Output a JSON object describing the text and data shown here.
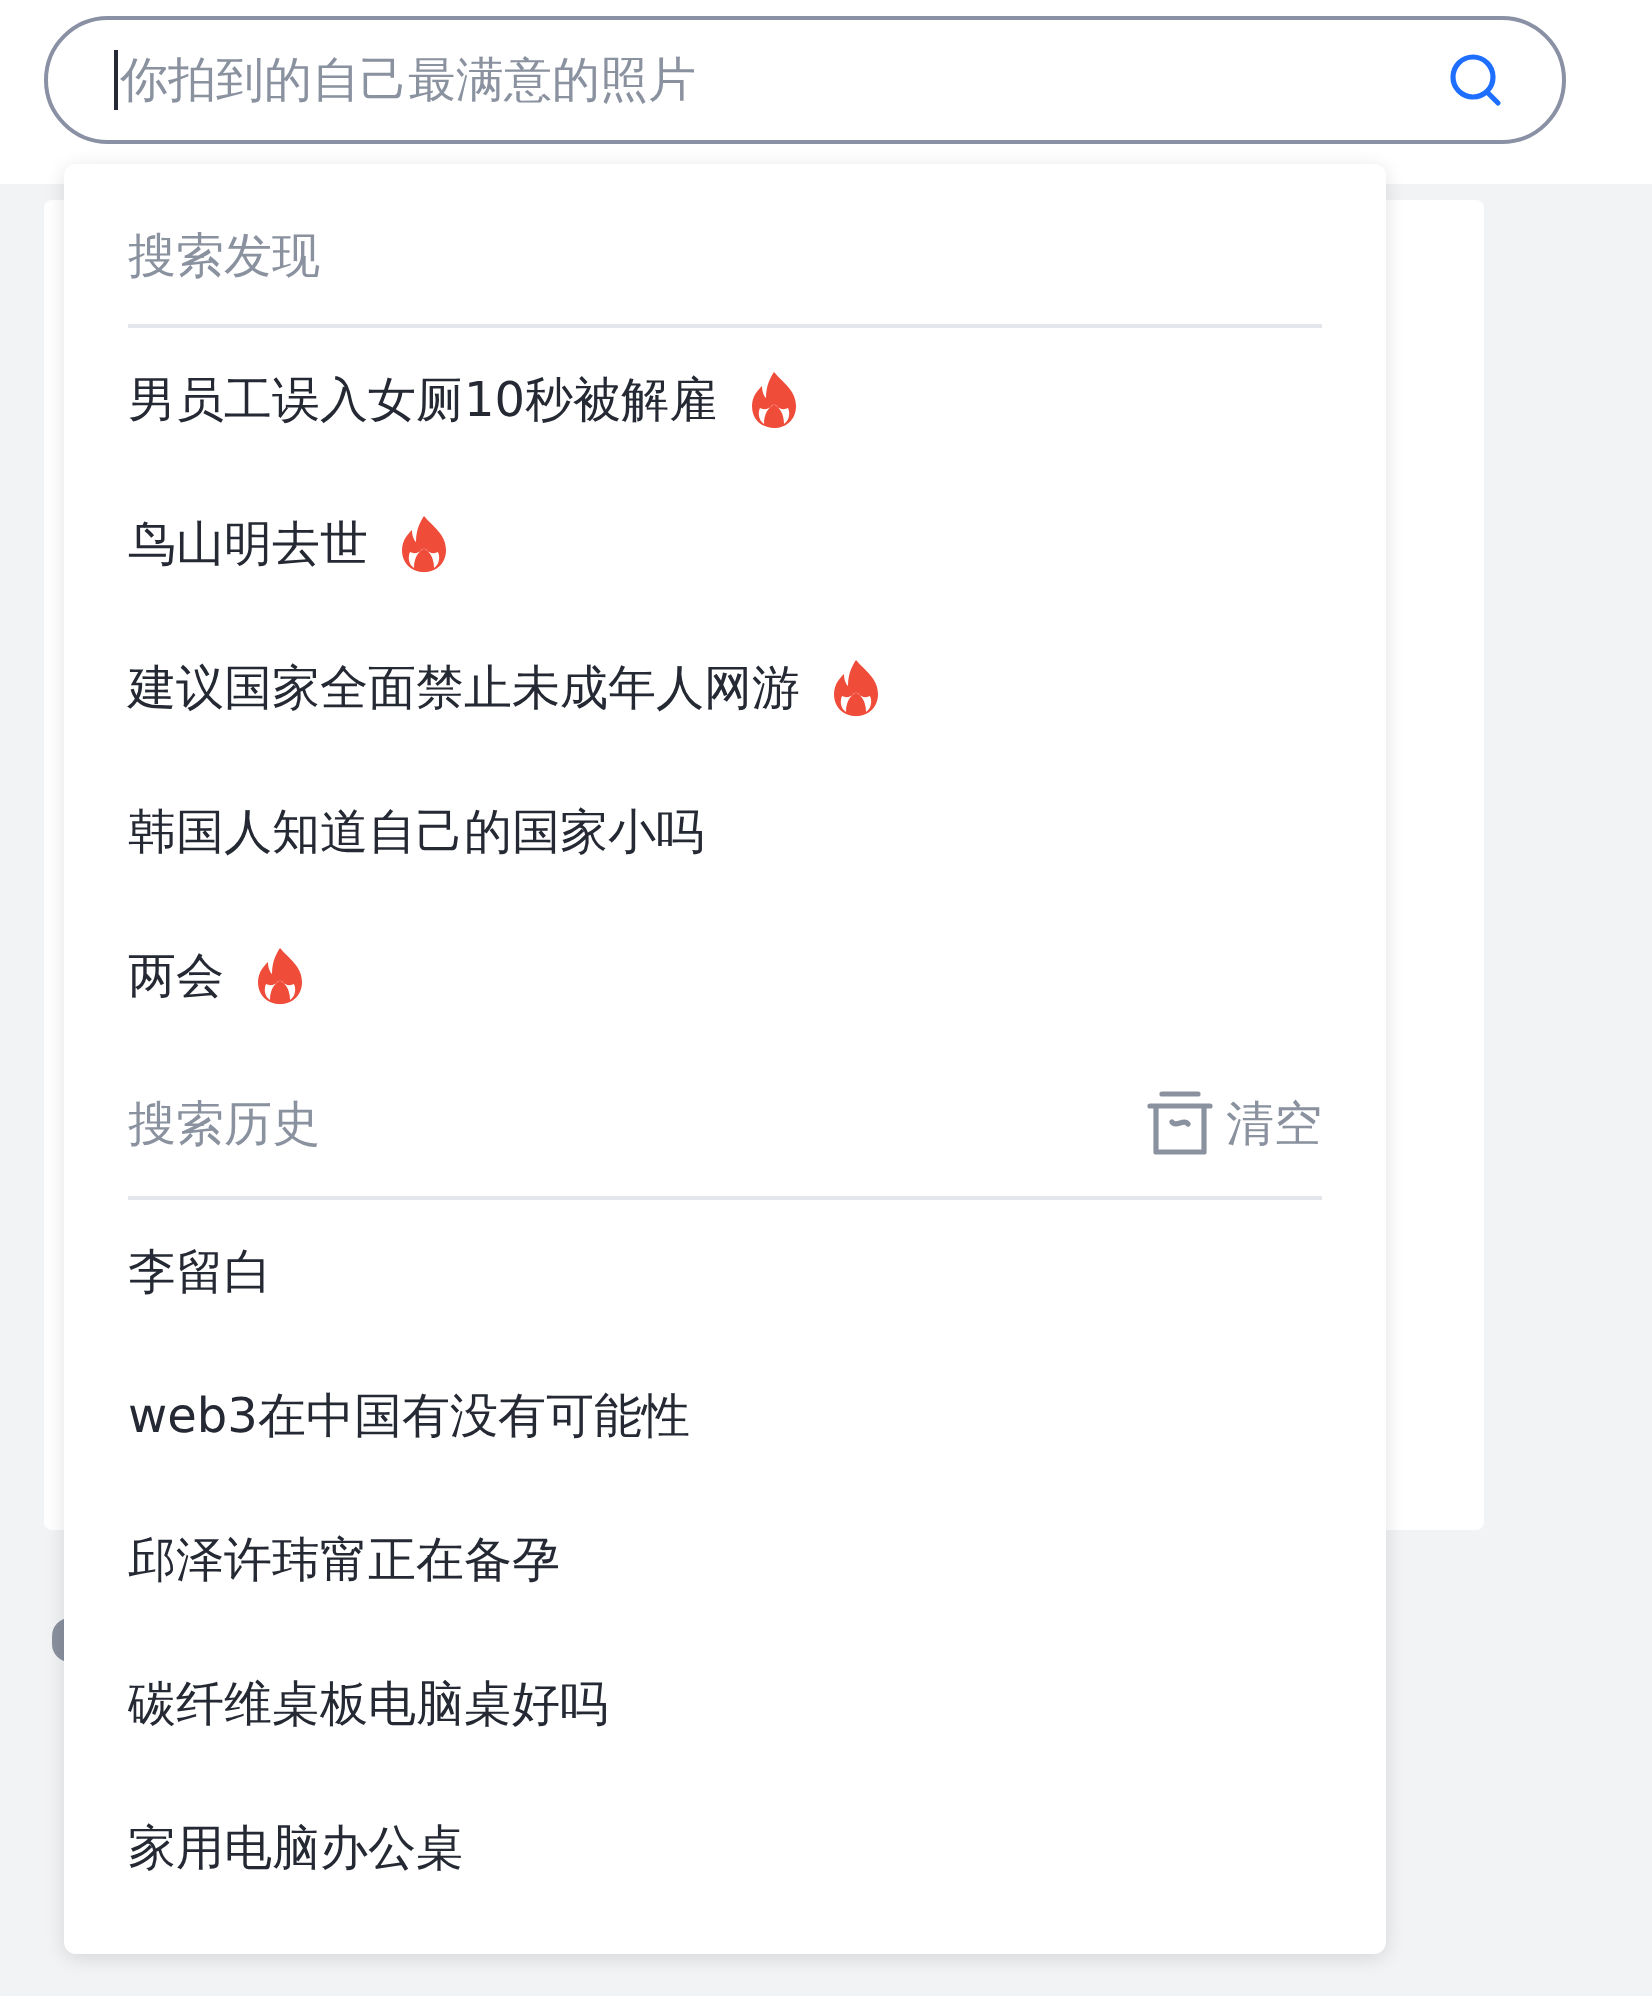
{
  "search": {
    "placeholder": "你拍到的自己最满意的照片",
    "focused": true
  },
  "discover": {
    "title": "搜索发现",
    "items": [
      {
        "text": "男员工误入女厕10秒被解雇",
        "hot": true
      },
      {
        "text": "鸟山明去世",
        "hot": true
      },
      {
        "text": "建议国家全面禁止未成年人网游",
        "hot": true
      },
      {
        "text": "韩国人知道自己的国家小吗",
        "hot": false
      },
      {
        "text": "两会",
        "hot": true
      }
    ]
  },
  "history": {
    "title": "搜索历史",
    "clear_label": "清空",
    "items": [
      {
        "text": "李留白"
      },
      {
        "text": "web3在中国有没有可能性"
      },
      {
        "text": "邱泽许玮甯正在备孕"
      },
      {
        "text": "碳纤维桌板电脑桌好吗"
      },
      {
        "text": "家用电脑办公桌"
      }
    ]
  }
}
